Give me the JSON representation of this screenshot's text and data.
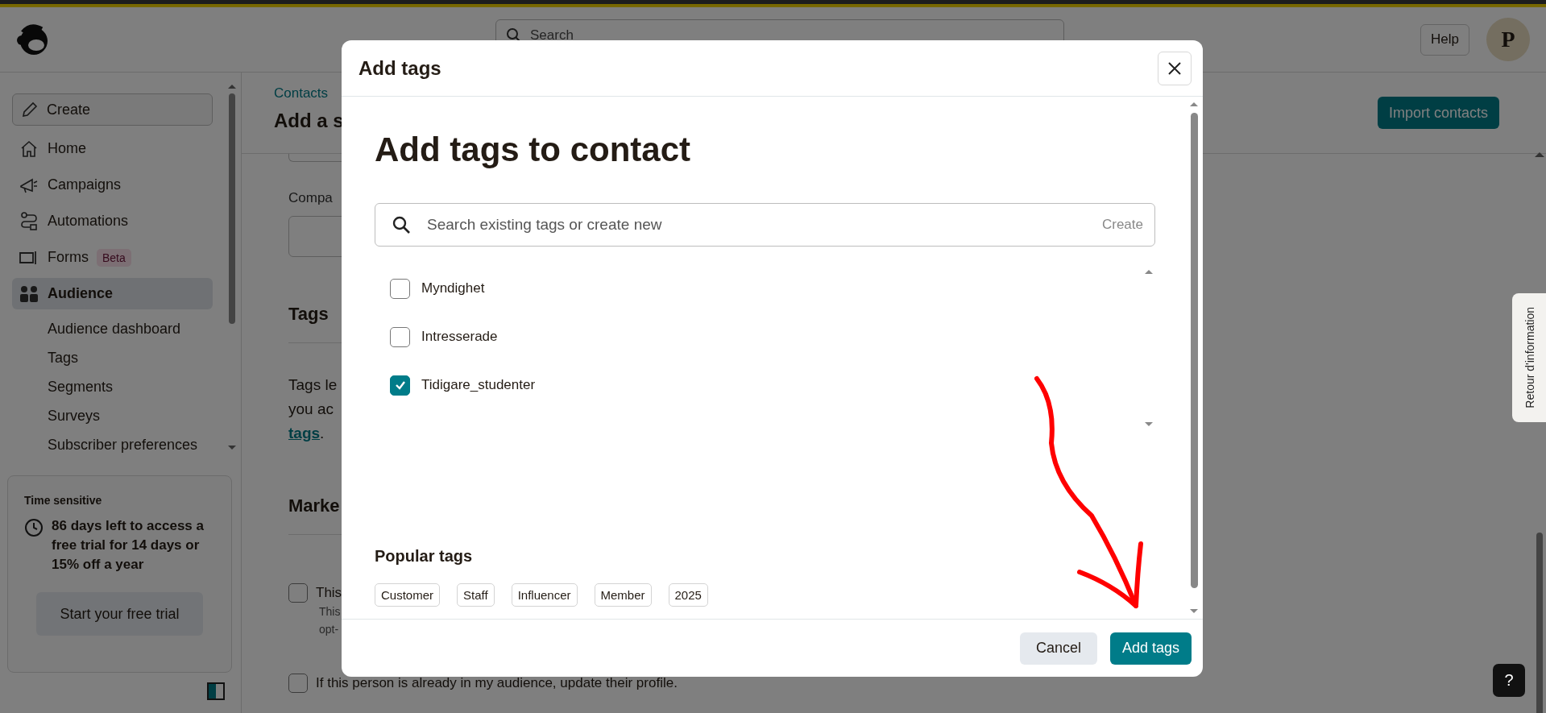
{
  "header": {
    "search_placeholder": "Search",
    "help": "Help",
    "avatar": "P"
  },
  "sidebar": {
    "create": "Create",
    "items": [
      {
        "label": "Home",
        "selected": false
      },
      {
        "label": "Campaigns",
        "selected": false
      },
      {
        "label": "Automations",
        "selected": false
      },
      {
        "label": "Forms",
        "badge": "Beta",
        "selected": false
      },
      {
        "label": "Audience",
        "selected": true
      }
    ],
    "subitems": [
      "Audience dashboard",
      "Tags",
      "Segments",
      "Surveys",
      "Subscriber preferences"
    ],
    "trial": {
      "label": "Time sensitive",
      "message": "86 days left to access a free trial for 14 days or 15% off a year",
      "button": "Start your free trial"
    }
  },
  "main": {
    "breadcrumb": "Contacts",
    "title": "Add a s",
    "import_button": "Import contacts",
    "company_label": "Compa",
    "tags_heading": "Tags",
    "tags_text": [
      "Tags le",
      "you ac"
    ],
    "tags_link": "tags",
    "tags_link_end": ".",
    "marketing_heading": "Marke",
    "consent": [
      {
        "label": "This",
        "note": [
          "This",
          "opt-"
        ],
        "checked": false
      },
      {
        "label": "If this person is already in my audience, update their profile.",
        "checked": false
      }
    ]
  },
  "feedback_tab": "Retour d'information",
  "help_button": "?",
  "dialog": {
    "title": "Add tags",
    "heading": "Add tags to contact",
    "search": {
      "placeholder": "Search existing tags or create new",
      "action": "Create"
    },
    "tags": [
      {
        "label": "Myndighet",
        "checked": false
      },
      {
        "label": "Intresserade",
        "checked": false
      },
      {
        "label": "Tidigare_studenter",
        "checked": true
      }
    ],
    "popular_title": "Popular tags",
    "popular_tags": [
      "Customer",
      "Staff",
      "Influencer",
      "Member",
      "2025"
    ],
    "cancel": "Cancel",
    "confirm": "Add tags"
  }
}
